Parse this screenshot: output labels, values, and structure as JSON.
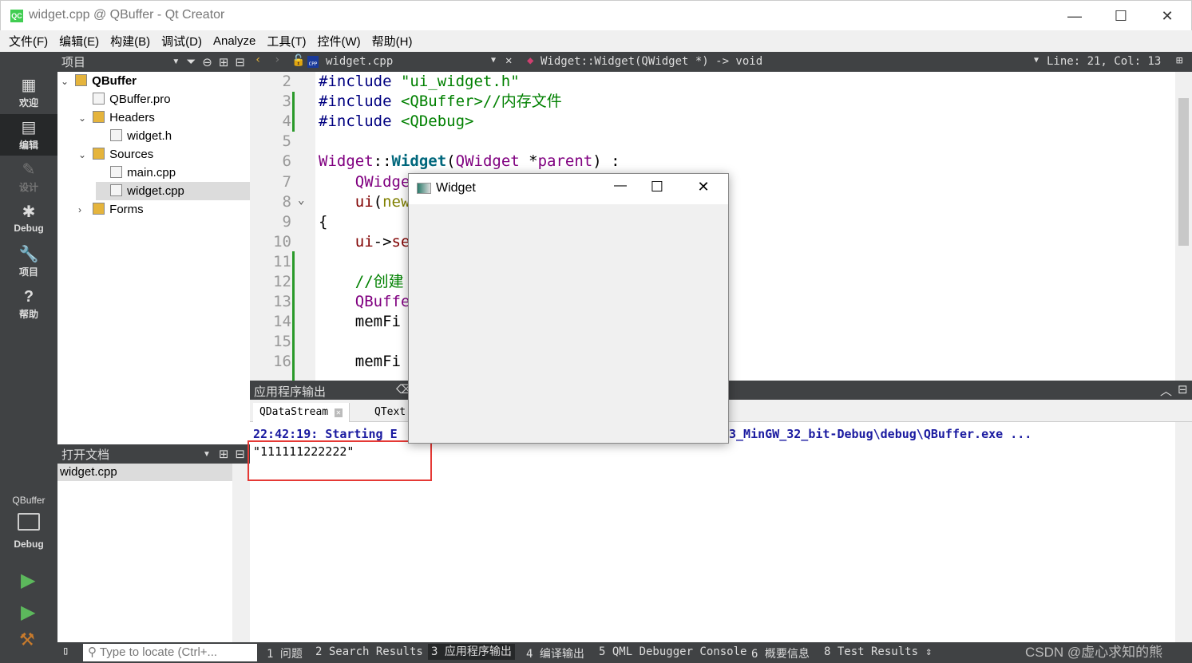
{
  "window": {
    "title": "widget.cpp @ QBuffer - Qt Creator",
    "minimize": "—",
    "maximize": "☐",
    "close": "✕"
  },
  "menu": [
    "文件(F)",
    "编辑(E)",
    "构建(B)",
    "调试(D)",
    "Analyze",
    "工具(T)",
    "控件(W)",
    "帮助(H)"
  ],
  "modes": [
    {
      "label": "欢迎",
      "icon": "grid-icon"
    },
    {
      "label": "编辑",
      "icon": "edit-icon"
    },
    {
      "label": "设计",
      "icon": "pencil-icon"
    },
    {
      "label": "Debug",
      "icon": "bug-icon"
    },
    {
      "label": "项目",
      "icon": "wrench-icon"
    },
    {
      "label": "帮助",
      "icon": "help-icon"
    }
  ],
  "kit": {
    "project": "QBuffer",
    "config": "Debug"
  },
  "project_pane": {
    "title": "项目"
  },
  "tree": [
    {
      "label": "QBuffer",
      "level": 0,
      "chevron": "⌄",
      "bold": true
    },
    {
      "label": "QBuffer.pro",
      "level": 1
    },
    {
      "label": "Headers",
      "level": 1,
      "chevron": "⌄"
    },
    {
      "label": "widget.h",
      "level": 2
    },
    {
      "label": "Sources",
      "level": 1,
      "chevron": "⌄"
    },
    {
      "label": "main.cpp",
      "level": 2
    },
    {
      "label": "widget.cpp",
      "level": 2,
      "selected": true
    },
    {
      "label": "Forms",
      "level": 1,
      "chevron": "›"
    }
  ],
  "open_docs": {
    "title": "打开文档",
    "items": [
      "widget.cpp"
    ]
  },
  "editor": {
    "file": "widget.cpp",
    "symbol": "Widget::Widget(QWidget *) -> void",
    "position": "Line: 21, Col: 13",
    "line_numbers": [
      "2",
      "3",
      "4",
      "5",
      "6",
      "7",
      "8",
      "9",
      "10",
      "11",
      "12",
      "13",
      "14",
      "15",
      "16"
    ],
    "lines": [
      [
        [
          "#include ",
          "k"
        ],
        [
          "\"ui_widget.h\"",
          "s"
        ]
      ],
      [
        [
          "#include ",
          "k"
        ],
        [
          "<QBuffer>",
          "s"
        ],
        [
          "//内存文件",
          "c"
        ]
      ],
      [
        [
          "#include ",
          "k"
        ],
        [
          "<QDebug>",
          "s"
        ]
      ],
      [],
      [
        [
          "Widget",
          "p"
        ],
        [
          "::",
          "n"
        ],
        [
          "Widget",
          "b"
        ],
        [
          "(",
          "n"
        ],
        [
          "QWidget",
          "p"
        ],
        [
          " *",
          "n"
        ],
        [
          "parent",
          "p"
        ],
        [
          ") :",
          "n"
        ]
      ],
      [
        [
          "    QWidge",
          "p"
        ]
      ],
      [
        [
          "    ui",
          "m"
        ],
        [
          "(",
          "n"
        ],
        [
          "new",
          "o"
        ]
      ],
      [
        [
          "{",
          "n"
        ]
      ],
      [
        [
          "    ui",
          "m"
        ],
        [
          "->",
          "n"
        ],
        [
          "se",
          "m"
        ]
      ],
      [],
      [
        [
          "    //创建",
          "c"
        ]
      ],
      [
        [
          "    QBuffe",
          "p"
        ]
      ],
      [
        [
          "    memFi",
          "n"
        ]
      ],
      [],
      [
        [
          "    memFi",
          "n"
        ]
      ]
    ]
  },
  "output_pane": {
    "title": "应用程序输出",
    "tabs": [
      "QDataStream",
      "QText"
    ],
    "start_line_a": "22:42:19: Starting E",
    "start_line_b": "3_MinGW_32_bit-Debug\\debug\\QBuffer.exe ...",
    "result": "\"111111222222\"",
    "highlight_color": "#e53935"
  },
  "widget_window": {
    "title": "Widget",
    "minimize": "—",
    "maximize": "☐",
    "close": "✕"
  },
  "statusbar": {
    "locate_placeholder": "Type to locate (Ctrl+...",
    "tabs": [
      "1 问题",
      "2 Search Results",
      "3 应用程序输出",
      "4 编译输出",
      "5 QML Debugger Console",
      "6 概要信息",
      "8 Test Results"
    ],
    "active_tab": 2,
    "watermark": "CSDN @虚心求知的熊"
  }
}
